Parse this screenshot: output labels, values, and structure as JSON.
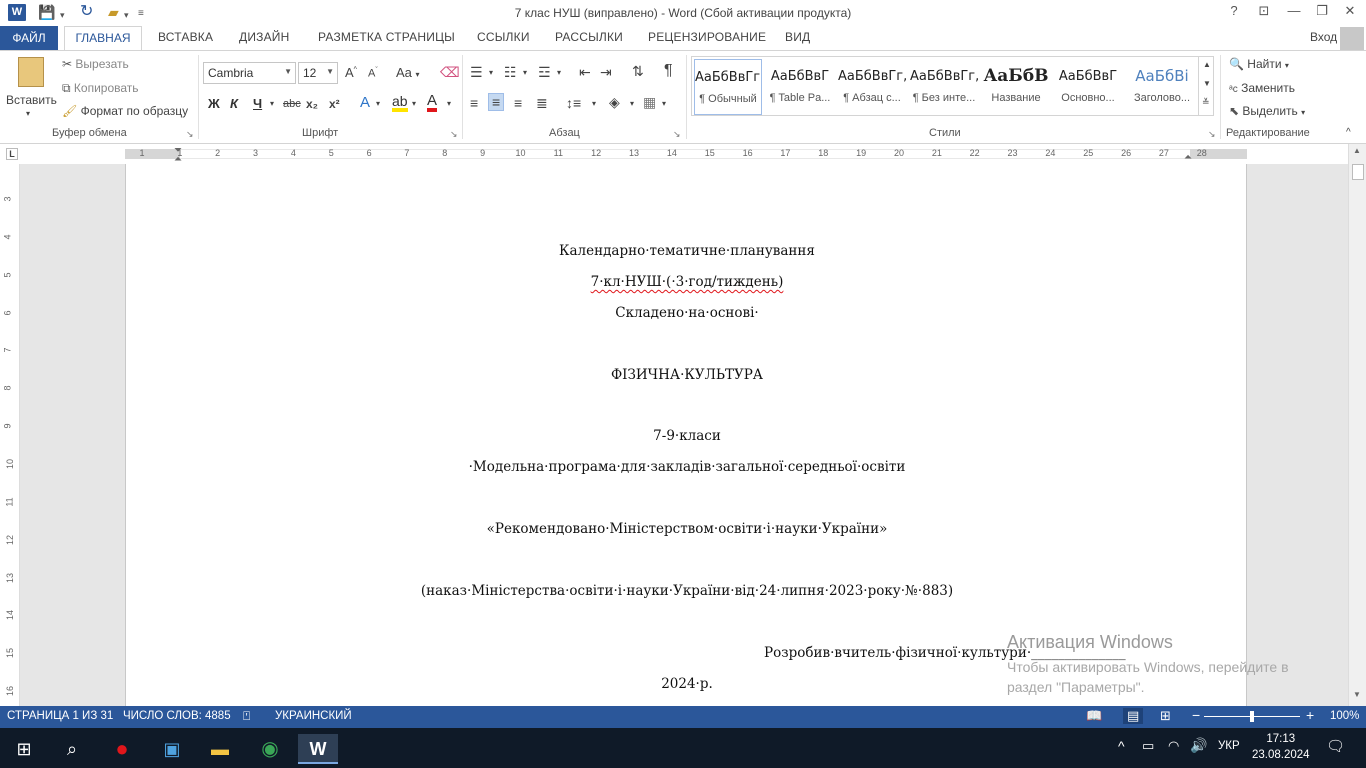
{
  "titlebar": {
    "app_icon": "W",
    "title": "7 клас НУШ (виправлено) - Word (Сбой активации продукта)",
    "help": "?",
    "ribbon_display": "⊡",
    "minimize": "—",
    "restore": "❐",
    "close": "✕"
  },
  "tabs": {
    "file": "ФАЙЛ",
    "home": "ГЛАВНАЯ",
    "insert": "ВСТАВКА",
    "design": "ДИЗАЙН",
    "layout": "РАЗМЕТКА СТРАНИЦЫ",
    "references": "ССЫЛКИ",
    "mailings": "РАССЫЛКИ",
    "review": "РЕЦЕНЗИРОВАНИЕ",
    "view": "ВИД",
    "signin": "Вход"
  },
  "clipboard": {
    "paste": "Вставить",
    "cut": "Вырезать",
    "copy": "Копировать",
    "format_painter": "Формат по образцу",
    "label": "Буфер обмена"
  },
  "font": {
    "name": "Cambria",
    "size": "12",
    "label": "Шрифт",
    "change_case": "Aa",
    "bold": "Ж",
    "italic": "К",
    "underline": "Ч",
    "strike": "abc",
    "subscript": "x₂",
    "superscript": "x²"
  },
  "paragraph": {
    "label": "Абзац",
    "pilcrow": "¶"
  },
  "styles": {
    "label": "Стили",
    "items": [
      {
        "preview": "АаБбВвГг,",
        "name": "¶ Обычный"
      },
      {
        "preview": "АаБбВвГ",
        "name": "¶ Table Pa..."
      },
      {
        "preview": "АаБбВвГг,",
        "name": "¶ Абзац с..."
      },
      {
        "preview": "АаБбВвГг,",
        "name": "¶ Без инте..."
      },
      {
        "preview": "АаБбВ",
        "name": "Название"
      },
      {
        "preview": "АаБбВвГ",
        "name": "Основно..."
      },
      {
        "preview": "АаБбВі",
        "name": "Заголово..."
      }
    ]
  },
  "editing": {
    "label": "Редактирование",
    "find": "Найти",
    "replace": "Заменить",
    "select": "Выделить"
  },
  "ruler": {
    "marks": [
      "1",
      "1",
      "2",
      "3",
      "4",
      "5",
      "6",
      "7",
      "8",
      "9",
      "10",
      "11",
      "12",
      "13",
      "14",
      "15",
      "16",
      "17",
      "18",
      "19",
      "20",
      "21",
      "22",
      "23",
      "24",
      "25",
      "26",
      "27",
      "28"
    ],
    "vmarks": [
      "3",
      "4",
      "5",
      "6",
      "7",
      "8",
      "9",
      "10",
      "11",
      "12",
      "13",
      "14",
      "15",
      "16"
    ]
  },
  "document": {
    "lines": [
      "Календарно·тематичне·планування",
      "7·кл·НУШ·(·3·год/тиждень)",
      "Складено·на·основі·",
      "ФІЗИЧНА·КУЛЬТУРА",
      "7-9·класи",
      "·Модельна·програма·для·закладів·загальної·середньої·освіти",
      "«Рекомендовано·Міністерством·освіти·і·науки·України»",
      "(наказ·Міністерства·освіти·і·науки·України·від·24·липня·2023·року·№·883)",
      "Розробив·вчитель·фізичної·культури·______________",
      "2024·р."
    ]
  },
  "watermark": {
    "title": "Активация Windows",
    "text": "Чтобы активировать Windows, перейдите в раздел \"Параметры\"."
  },
  "status": {
    "page": "СТРАНИЦА 1 ИЗ 31",
    "words": "ЧИСЛО СЛОВ: 4885",
    "language": "УКРАИНСКИЙ",
    "zoom": "100%"
  },
  "taskbar": {
    "lang": "УКР",
    "time": "17:13",
    "date": "23.08.2024"
  }
}
